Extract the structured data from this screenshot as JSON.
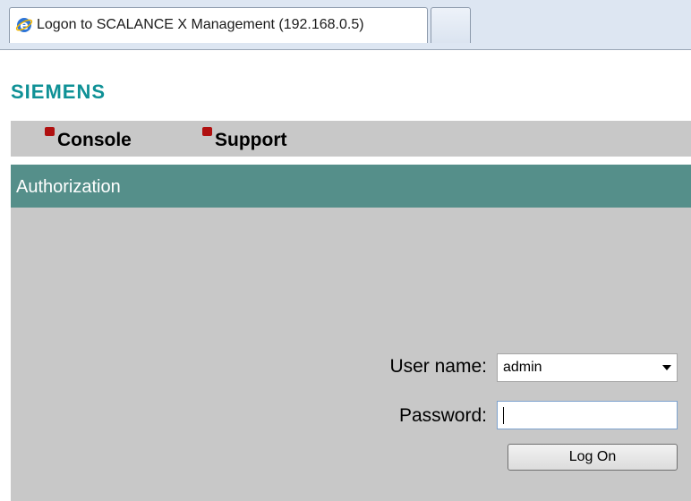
{
  "browser": {
    "active_tab_title": "Logon to SCALANCE X Management (192.168.0.5)",
    "tab_icon": "ie-icon"
  },
  "brand": {
    "logo_text": "SIEMENS"
  },
  "nav": {
    "items": [
      {
        "label": "Console",
        "icon": "bullet-icon"
      },
      {
        "label": "Support",
        "icon": "bullet-icon"
      }
    ]
  },
  "section": {
    "title": "Authorization"
  },
  "form": {
    "username_label": "User name:",
    "username_value": "admin",
    "password_label": "Password:",
    "password_value": "",
    "submit_label": "Log On"
  },
  "colors": {
    "brand": "#0f9196",
    "section_bar": "#558f8a",
    "panel": "#c8c8c8",
    "bullet": "#b01010"
  }
}
